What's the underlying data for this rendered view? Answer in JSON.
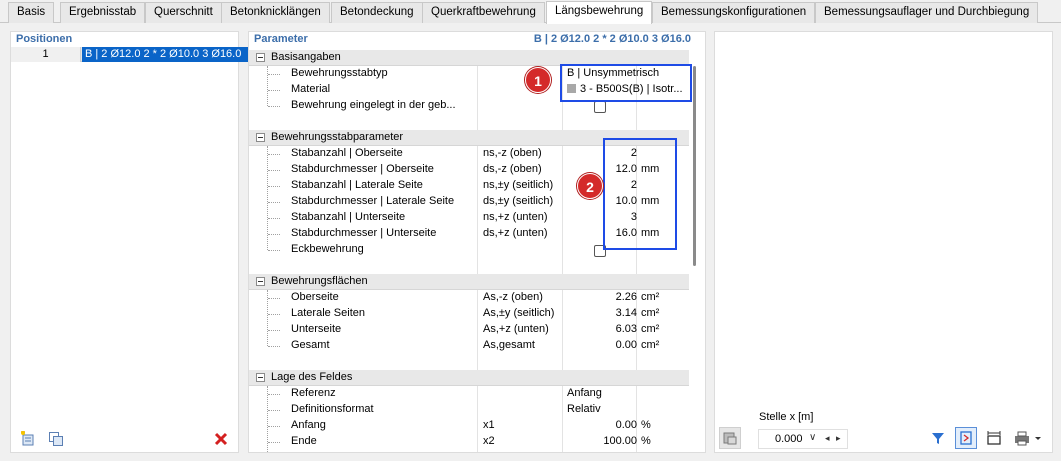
{
  "tabs": [
    "Basis",
    "Ergebnisstab",
    "Querschnitt",
    "Betonknicklängen",
    "Betondeckung",
    "Querkraftbewehrung",
    "Längsbewehrung",
    "Bemessungskonfigurationen",
    "Bemessungsauflager und Durchbiegung"
  ],
  "active_tab": "Längsbewehrung",
  "positions": {
    "title": "Positionen",
    "row_num": "1",
    "row_value": "B | 2 Ø12.0 2 * 2 Ø10.0 3 Ø16.0"
  },
  "parameter": {
    "title": "Parameter",
    "summary": "B | 2 Ø12.0 2 * 2 Ø10.0 3 Ø16.0",
    "sections": {
      "basis": {
        "title": "Basisangaben",
        "rows": [
          {
            "name": "Bewehrungsstabtyp",
            "value": "B | Unsymmetrisch"
          },
          {
            "name": "Material",
            "value": "3 - B500S(B) | Isotr..."
          },
          {
            "name": "Bewehrung eingelegt in der geb...",
            "value": ""
          }
        ]
      },
      "stab": {
        "title": "Bewehrungsstabparameter",
        "rows": [
          {
            "name": "Stabanzahl | Oberseite",
            "sym": "ns,-z (oben)",
            "value": "2",
            "unit": ""
          },
          {
            "name": "Stabdurchmesser | Oberseite",
            "sym": "ds,-z (oben)",
            "value": "12.0",
            "unit": "mm"
          },
          {
            "name": "Stabanzahl | Laterale Seite",
            "sym": "ns,±y (seitlich)",
            "value": "2",
            "unit": ""
          },
          {
            "name": "Stabdurchmesser | Laterale Seite",
            "sym": "ds,±y (seitlich)",
            "value": "10.0",
            "unit": "mm"
          },
          {
            "name": "Stabanzahl | Unterseite",
            "sym": "ns,+z (unten)",
            "value": "3",
            "unit": ""
          },
          {
            "name": "Stabdurchmesser | Unterseite",
            "sym": "ds,+z (unten)",
            "value": "16.0",
            "unit": "mm"
          },
          {
            "name": "Eckbewehrung",
            "sym": "",
            "value": "",
            "unit": ""
          }
        ]
      },
      "flaechen": {
        "title": "Bewehrungsflächen",
        "rows": [
          {
            "name": "Oberseite",
            "sym": "As,-z (oben)",
            "value": "2.26",
            "unit": "cm²"
          },
          {
            "name": "Laterale Seiten",
            "sym": "As,±y (seitlich)",
            "value": "3.14",
            "unit": "cm²"
          },
          {
            "name": "Unterseite",
            "sym": "As,+z (unten)",
            "value": "6.03",
            "unit": "cm²"
          },
          {
            "name": "Gesamt",
            "sym": "As,gesamt",
            "value": "0.00",
            "unit": "cm²"
          }
        ]
      },
      "lage": {
        "title": "Lage des Feldes",
        "rows": [
          {
            "name": "Referenz",
            "sym": "",
            "value": "Anfang",
            "unit": ""
          },
          {
            "name": "Definitionsformat",
            "sym": "",
            "value": "Relativ",
            "unit": ""
          },
          {
            "name": "Anfang",
            "sym": "x1",
            "value": "0.00",
            "unit": "%"
          },
          {
            "name": "Ende",
            "sym": "x2",
            "value": "100.00",
            "unit": "%"
          }
        ]
      }
    },
    "badges": [
      "1",
      "2"
    ]
  },
  "right": {
    "stelle_label": "Stelle x [m]",
    "stelle_value": "0.000"
  },
  "colors": {
    "accent": "#0a64c8",
    "annotation": "#1e4be6",
    "badge": "#d42a2a"
  }
}
